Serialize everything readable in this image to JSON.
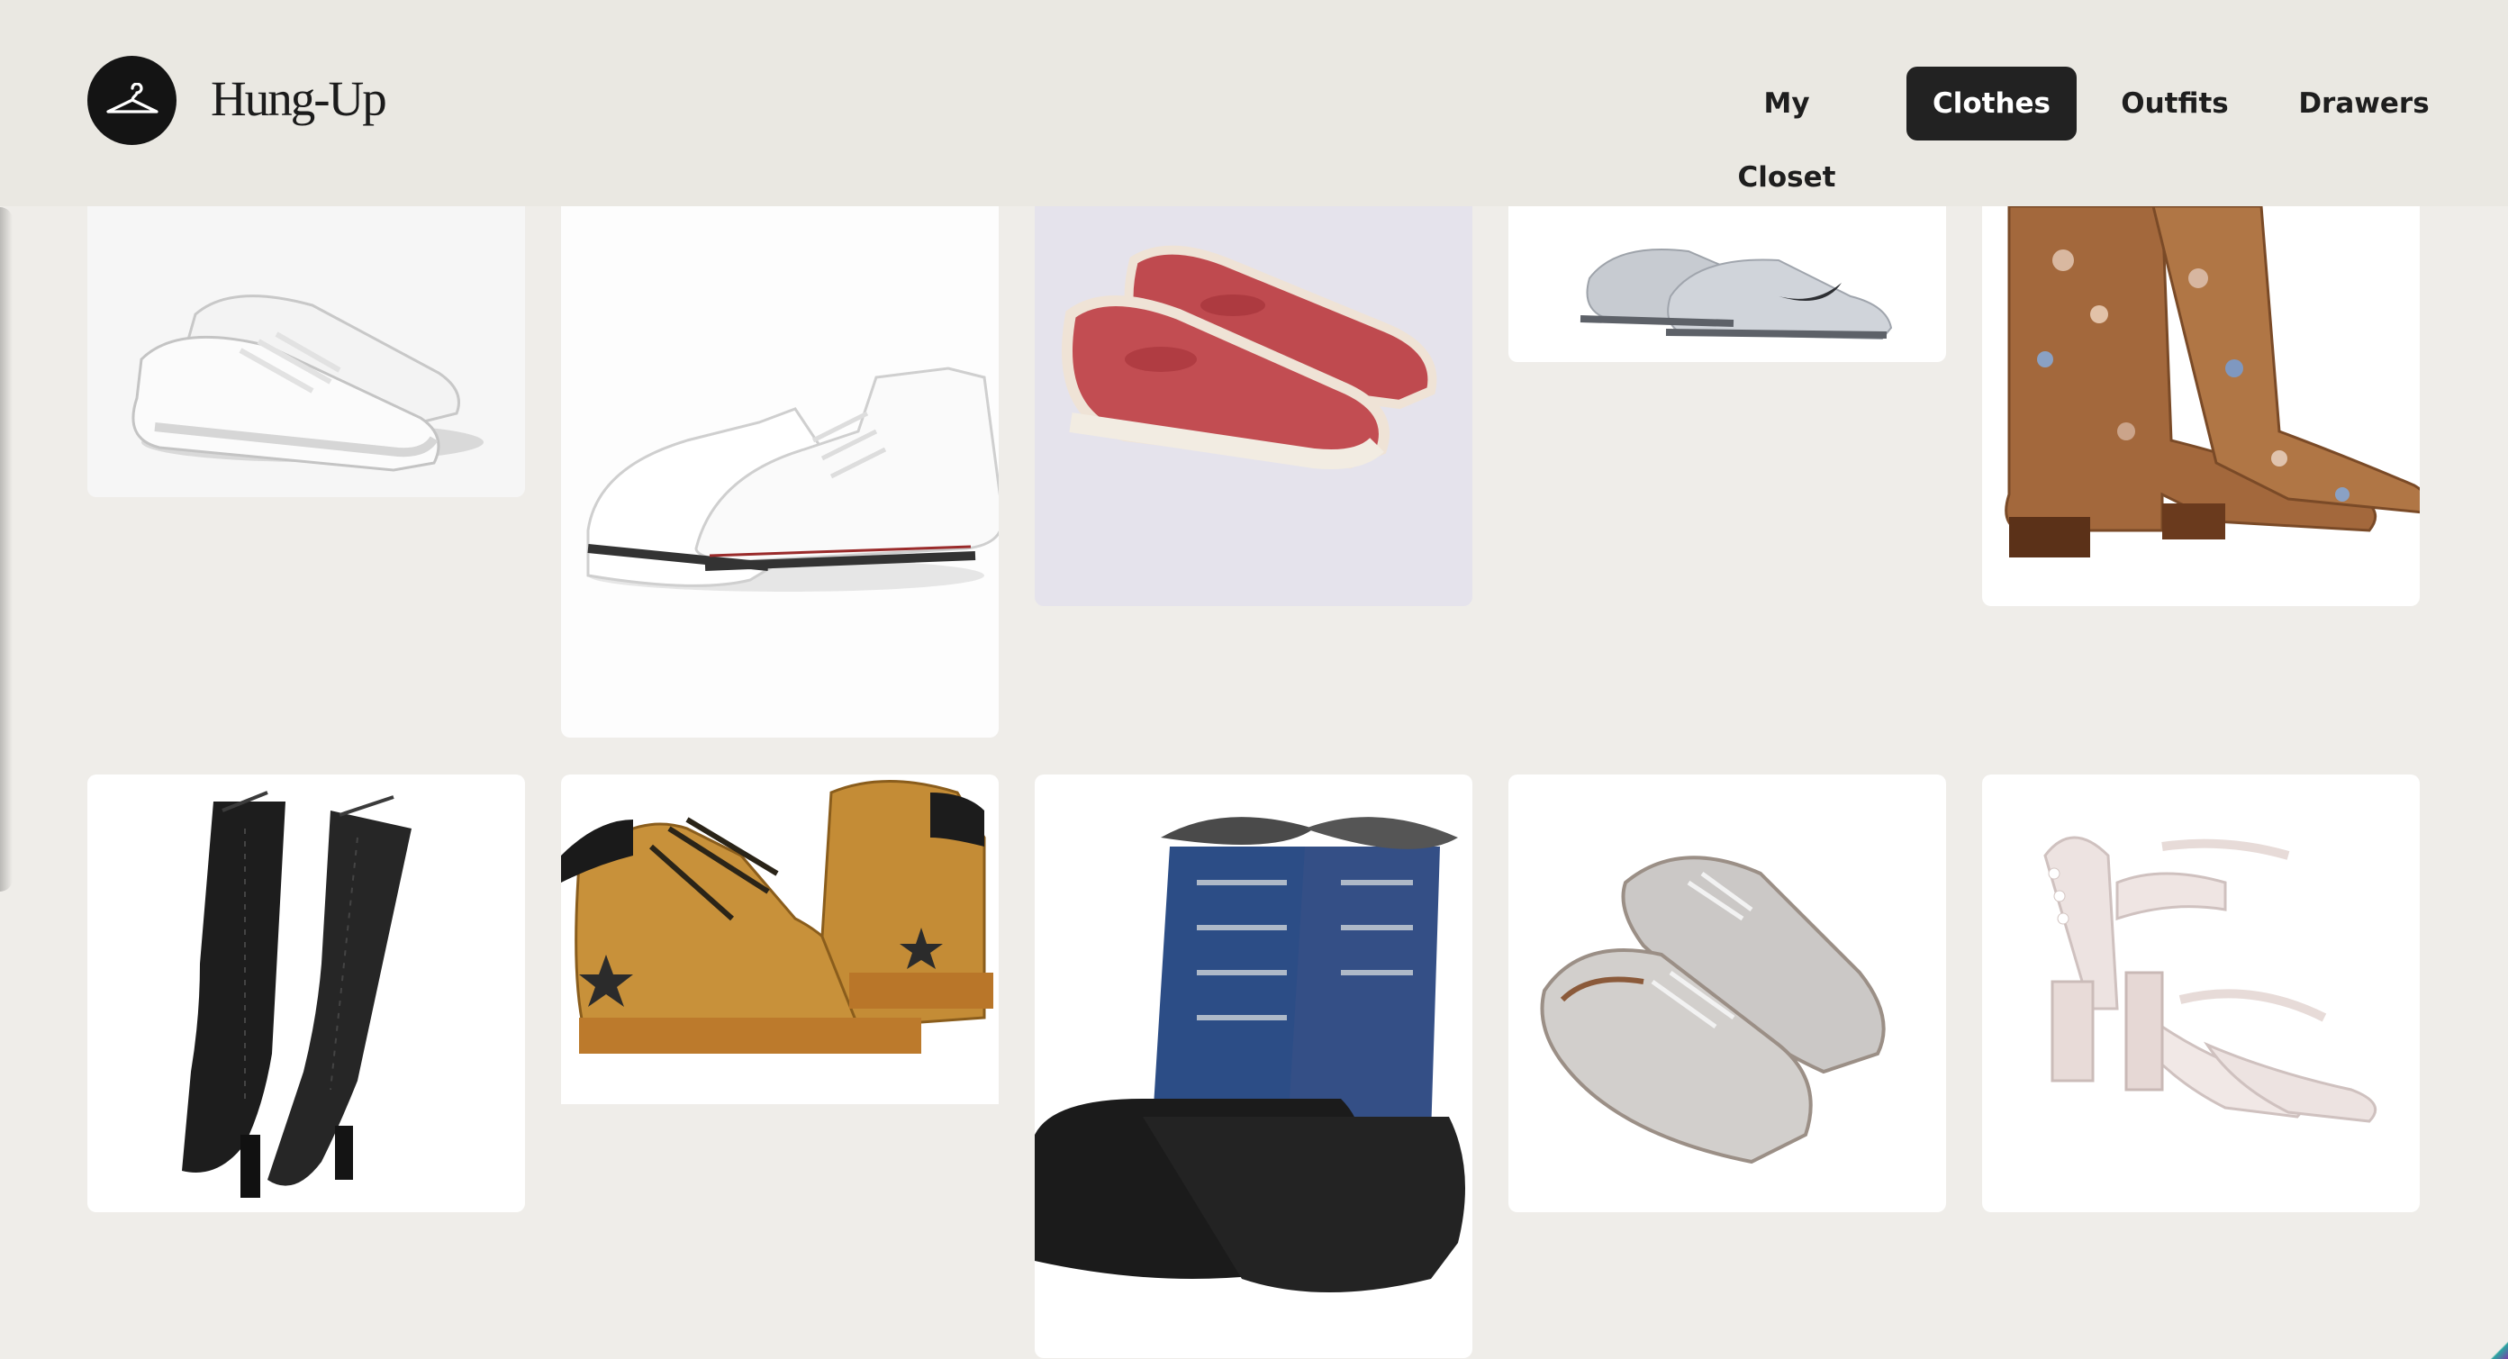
{
  "app": {
    "brand": "Hung-Up",
    "logo_icon": "hanger-icon"
  },
  "nav": {
    "items": [
      {
        "label": "My Closet",
        "active": false
      },
      {
        "label": "Clothes",
        "active": true
      },
      {
        "label": "Outfits",
        "active": false
      },
      {
        "label": "Drawers",
        "active": false
      }
    ]
  },
  "items": [
    {
      "image": "white-leather-sneakers-image"
    },
    {
      "image": "white-high-top-sneakers-image"
    },
    {
      "image": "red-slip-on-shoes-image"
    },
    {
      "image": "grey-running-shoes-image"
    },
    {
      "image": "embroidered-cowboy-boots-image"
    },
    {
      "image": "black-thigh-high-boots-image"
    },
    {
      "image": "tan-work-boots-image"
    },
    {
      "image": "blue-winter-snow-boots-image"
    },
    {
      "image": "grey-suede-oxfords-image"
    },
    {
      "image": "ivory-block-heel-sandals-image"
    }
  ],
  "colors": {
    "page_bg": "#efede9",
    "header_bg": "#eae8e2",
    "active_nav_bg": "#222222"
  }
}
